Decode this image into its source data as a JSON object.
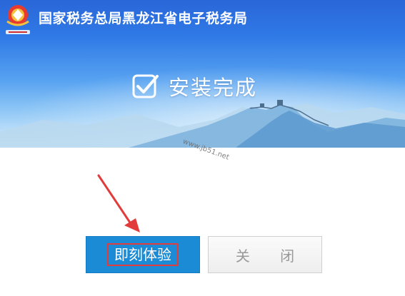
{
  "app": {
    "title": "国家税务总局黑龙江省电子税务局"
  },
  "status": {
    "text": "安装完成"
  },
  "watermark": {
    "text": "www.jb51.net"
  },
  "buttons": {
    "primary_label": "即刻体验",
    "close_label": "关 闭"
  },
  "colors": {
    "banner_blue": "#2f7ae6",
    "primary_button": "#1c8bd6",
    "annotation_red": "#e23b3b"
  }
}
